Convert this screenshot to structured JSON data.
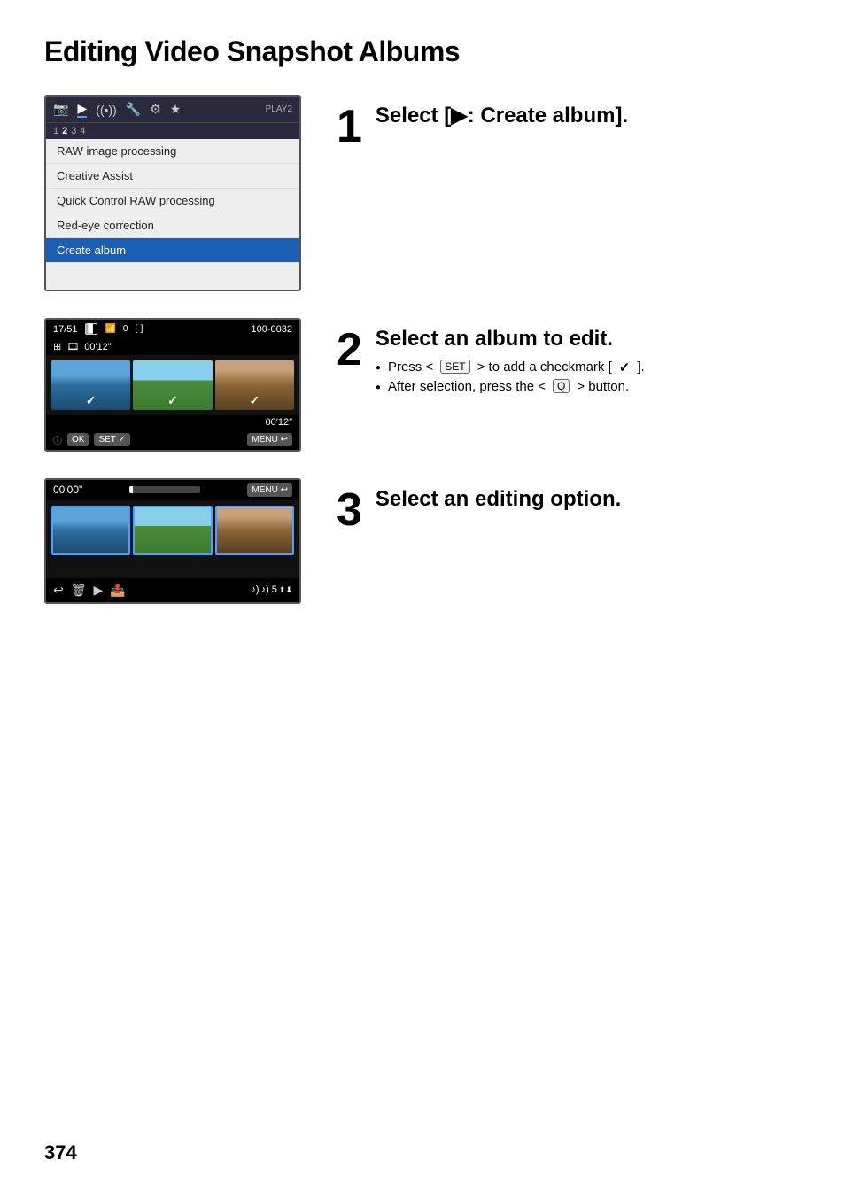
{
  "page": {
    "title": "Editing Video Snapshot Albums",
    "page_number": "374"
  },
  "steps": [
    {
      "number": "1",
      "title": "Select [▶: Create album].",
      "bullets": []
    },
    {
      "number": "2",
      "title": "Select an album to edit.",
      "bullets": [
        "Press <SET> to add a checkmark [✓].",
        "After selection, press the <Q> button."
      ]
    },
    {
      "number": "3",
      "title": "Select an editing option.",
      "bullets": []
    }
  ],
  "screen1": {
    "tabs": [
      "1",
      "2",
      "3",
      "4"
    ],
    "tab_label": "PLAY2",
    "menu_items": [
      "RAW image processing",
      "Creative Assist",
      "Quick Control RAW processing",
      "Red-eye correction",
      "Create album"
    ],
    "selected_item": 4
  },
  "screen2": {
    "counter": "17/51",
    "file": "100-0032",
    "time": "00'12\"",
    "ok_label": "OK",
    "set_label": "SET ✓",
    "menu_label": "MENU ↩"
  },
  "screen3": {
    "time_start": "00'00\"",
    "menu_label": "MENU ↩",
    "volume": "♪) 5",
    "tool_icons": [
      "↩",
      "🗑",
      "▶",
      "📤"
    ]
  }
}
